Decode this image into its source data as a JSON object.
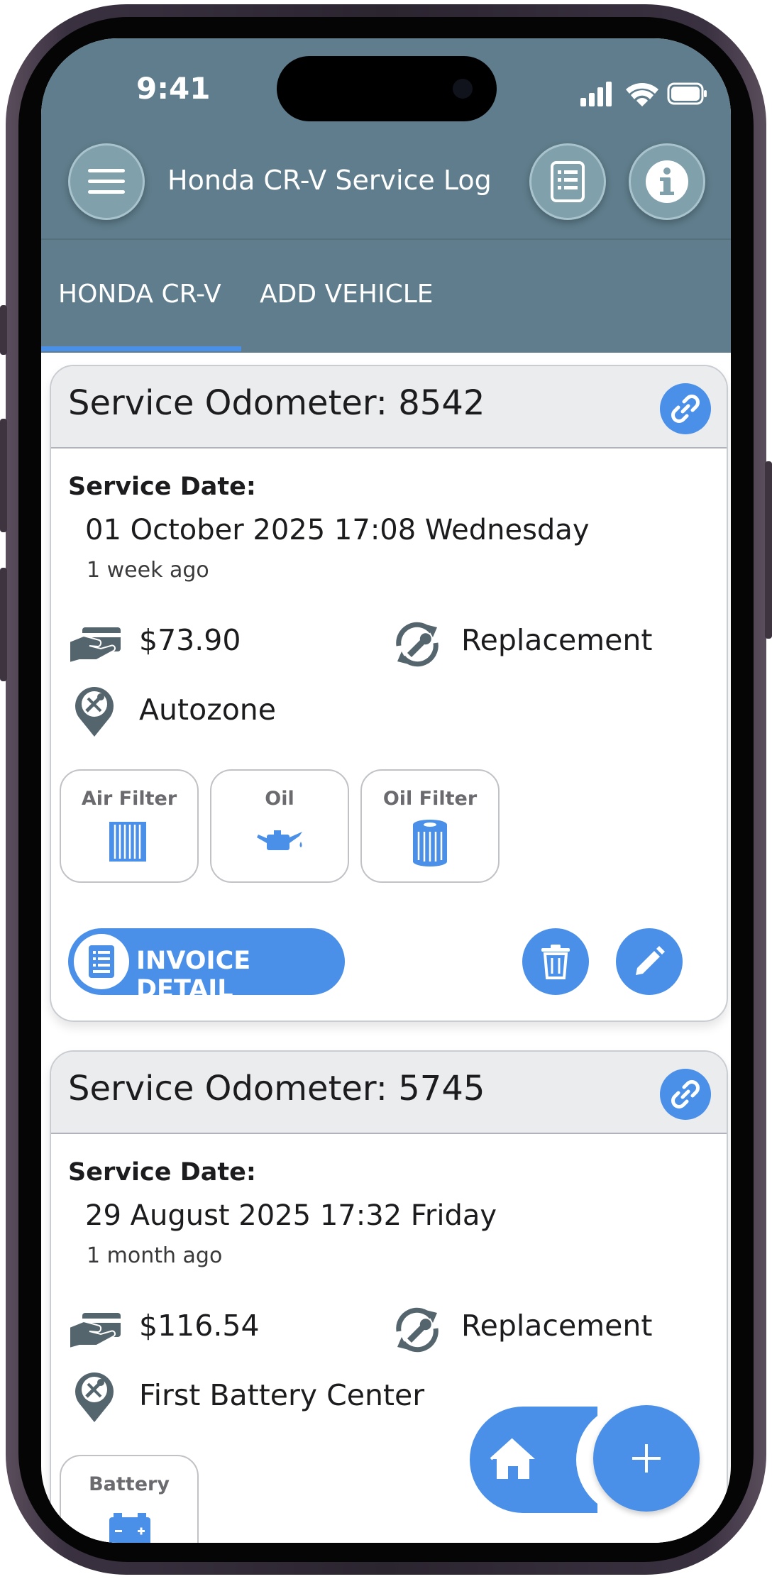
{
  "status_bar": {
    "time": "9:41"
  },
  "header": {
    "title": "Honda CR-V Service Log",
    "menu_icon": "hamburger-menu-icon",
    "report_icon": "report-list-icon",
    "info_icon": "info-icon"
  },
  "tabs": [
    {
      "label": "HONDA CR-V",
      "selected": true
    },
    {
      "label": "ADD VEHICLE",
      "selected": false
    }
  ],
  "records": [
    {
      "odometer_label": "Service Odometer: 8542",
      "date_label": "Service Date:",
      "date": "01 October 2025 17:08 Wednesday",
      "ago": "1 week ago",
      "cost": "$73.90",
      "type": "Replacement",
      "location": "Autozone",
      "items": [
        {
          "label": "Air Filter",
          "icon": "air-filter-icon"
        },
        {
          "label": "Oil",
          "icon": "oil-can-icon"
        },
        {
          "label": "Oil Filter",
          "icon": "oil-filter-icon"
        }
      ],
      "invoice_label": "INVOICE DETAIL"
    },
    {
      "odometer_label": "Service Odometer: 5745",
      "date_label": "Service Date:",
      "date": "29 August 2025 17:32 Friday",
      "ago": "1 month ago",
      "cost": "$116.54",
      "type": "Replacement",
      "location": "First Battery Center",
      "items": [
        {
          "label": "Battery",
          "icon": "battery-icon"
        }
      ]
    }
  ],
  "fab": {
    "home_icon": "home-icon",
    "add_label": "+"
  },
  "colors": {
    "header": "#5f7d8c",
    "accent": "#4a8fe8",
    "icon_gray": "#55656d",
    "card_head": "#ebecee"
  }
}
